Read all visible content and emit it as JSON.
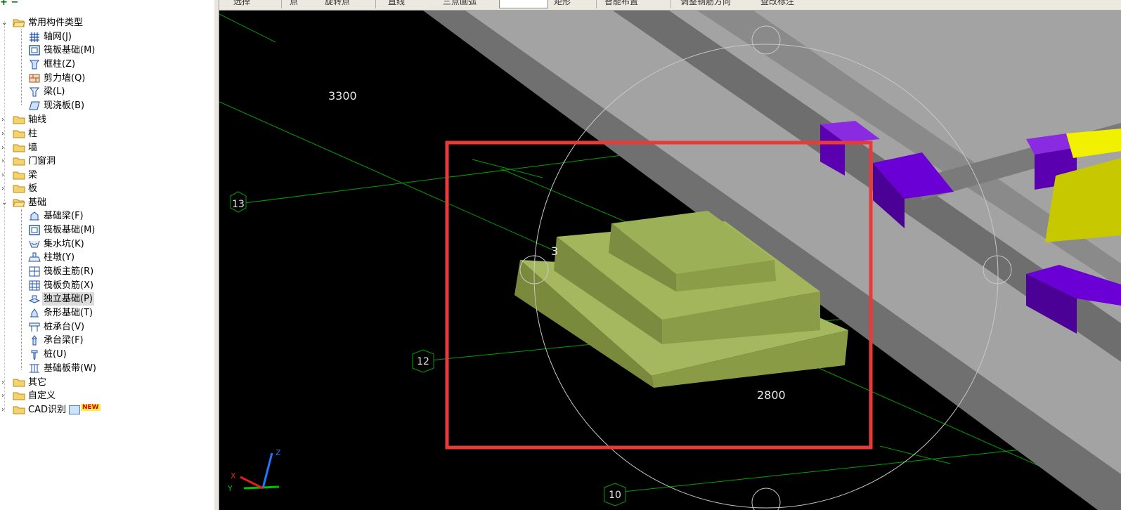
{
  "toolbar": {
    "items": [
      "选择",
      "点",
      "旋转点",
      "直线",
      "三点画弧",
      "矩形",
      "智能布置",
      "调整钢筋方向",
      "查改标注"
    ]
  },
  "tree": {
    "common": {
      "label": "常用构件类型",
      "children": [
        "轴网(J)",
        "筏板基础(M)",
        "框柱(Z)",
        "剪力墙(Q)",
        "梁(L)",
        "现浇板(B)"
      ]
    },
    "groups": [
      "轴线",
      "柱",
      "墙",
      "门窗洞",
      "梁",
      "板"
    ],
    "foundation": {
      "label": "基础",
      "children": [
        "基础梁(F)",
        "筏板基础(M)",
        "集水坑(K)",
        "柱墩(Y)",
        "筏板主筋(R)",
        "筏板负筋(X)",
        "独立基础(P)",
        "条形基础(T)",
        "桩承台(V)",
        "承台梁(F)",
        "桩(U)",
        "基础板带(W)"
      ],
      "selected_index": 6
    },
    "others": [
      "其它",
      "自定义",
      "CAD识别"
    ],
    "new_badge": "NEW"
  },
  "viewport": {
    "dims": [
      "3300",
      "2800",
      "3"
    ],
    "axis_labels": [
      "13",
      "12",
      "10"
    ],
    "triad": {
      "x": "X",
      "y": "Y",
      "z": "Z"
    },
    "colors": {
      "background": "#000000",
      "grid": "#00a000",
      "footing": "#9db55c",
      "slab": "#a3a3a3",
      "beam": "#6e6e6e",
      "column_purple": "#6a00d6",
      "column_yellow": "#f0f000",
      "highlight": "#e83a3a"
    }
  }
}
